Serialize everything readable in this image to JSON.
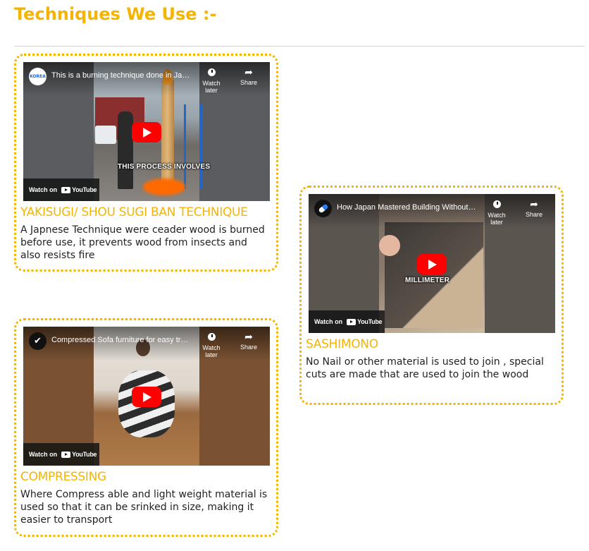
{
  "page": {
    "title": "Techniques We Use :-"
  },
  "cards": [
    {
      "title": "YAKISUGI/ SHOU SUGI BAN TECHNIQUE",
      "description": "A Japnese Technique were ceader wood is burned before use, it prevents wood from insects and also resists fire",
      "video": {
        "title": "This is a burning technique done in Japan...",
        "channel_label": "KOREA",
        "overlay_caption": "THIS PROCESS INVOLVES",
        "watch_later": "Watch later",
        "share": "Share",
        "watch_on": "Watch on",
        "youtube": "YouTube"
      }
    },
    {
      "title": "SASHIMONO",
      "description": "No Nail or other material is used to join , special cuts are made that are used to join the wood",
      "video": {
        "title": "How Japan Mastered Building Without Nails",
        "overlay_caption": "MILLIMETER",
        "watch_later": "Watch later",
        "share": "Share",
        "watch_on": "Watch on",
        "youtube": "YouTube"
      }
    },
    {
      "title": "COMPRESSING",
      "description": "Where Compress able and light weight material is used so that it can be srinked in size, making it easier to transport",
      "video": {
        "title": "Compressed Sofa furniture for easy transport",
        "watch_later": "Watch later",
        "share": "Share",
        "watch_on": "Watch on",
        "youtube": "YouTube"
      }
    }
  ],
  "colors": {
    "accent": "#f5b400",
    "play": "#ff0000",
    "text": "#222222"
  }
}
